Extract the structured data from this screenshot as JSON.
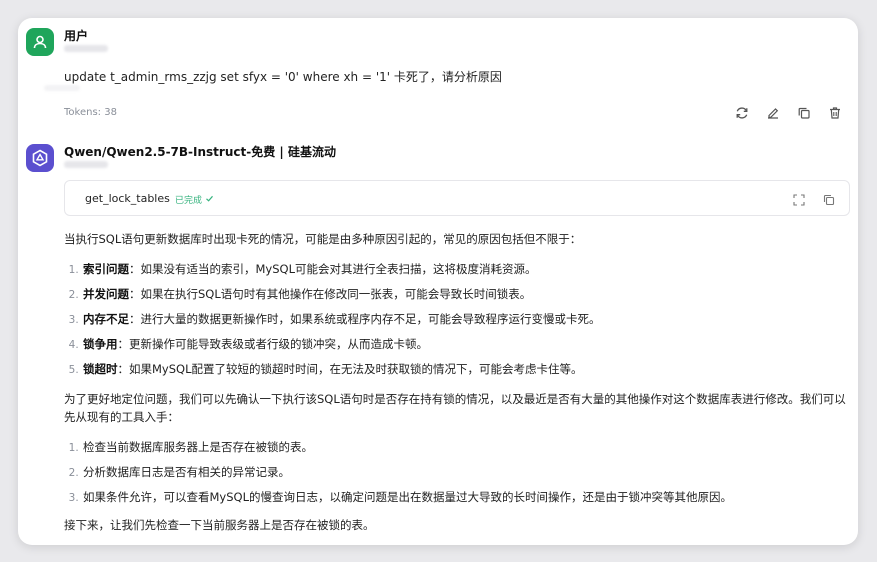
{
  "user": {
    "name": "用户",
    "message": "update t_admin_rms_zzjg set sfyx = '0' where xh = '1' 卡死了，请分析原因",
    "tokens": "Tokens: 38"
  },
  "assistant": {
    "name": "Qwen/Qwen2.5-7B-Instruct-免费 | 硅基流动",
    "tool_name": "get_lock_tables",
    "tool_status": "已完成",
    "intro": "当执行SQL语句更新数据库时出现卡死的情况，可能是由多种原因引起的，常见的原因包括但不限于：",
    "causes": [
      {
        "title": "索引问题",
        "text": "：如果没有适当的索引，MySQL可能会对其进行全表扫描，这将极度消耗资源。"
      },
      {
        "title": "并发问题",
        "text": "：如果在执行SQL语句时有其他操作在修改同一张表，可能会导致长时间锁表。"
      },
      {
        "title": "内存不足",
        "text": "：进行大量的数据更新操作时，如果系统或程序内存不足，可能会导致程序运行变慢或卡死。"
      },
      {
        "title": "锁争用",
        "text": "：更新操作可能导致表级或者行级的锁冲突，从而造成卡顿。"
      },
      {
        "title": "锁超时",
        "text": "：如果MySQL配置了较短的锁超时时间，在无法及时获取锁的情况下，可能会考虑卡住等。"
      }
    ],
    "para2": "为了更好地定位问题，我们可以先确认一下执行该SQL语句时是否存在持有锁的情况，以及最近是否有大量的其他操作对这个数据库表进行修改。我们可以先从现有的工具入手：",
    "steps": [
      "检查当前数据库服务器上是否存在被锁的表。",
      "分析数据库日志是否有相关的异常记录。",
      "如果条件允许，可以查看MySQL的慢查询日志，以确定问题是出在数据量过大导致的长时间操作，还是由于锁冲突等其他原因。"
    ],
    "closing": "接下来，让我们先检查一下当前服务器上是否存在被锁的表。"
  },
  "icons": [
    "user-avatar-icon",
    "regenerate-icon",
    "edit-icon",
    "copy-icon",
    "delete-icon",
    "qwen-logo-icon",
    "check-icon",
    "expand-icon",
    "copy-tool-icon"
  ],
  "colors": {
    "user_avatar": "#1fa55b",
    "bot_avatar": "#5b4fcf",
    "success": "#36b37e"
  }
}
